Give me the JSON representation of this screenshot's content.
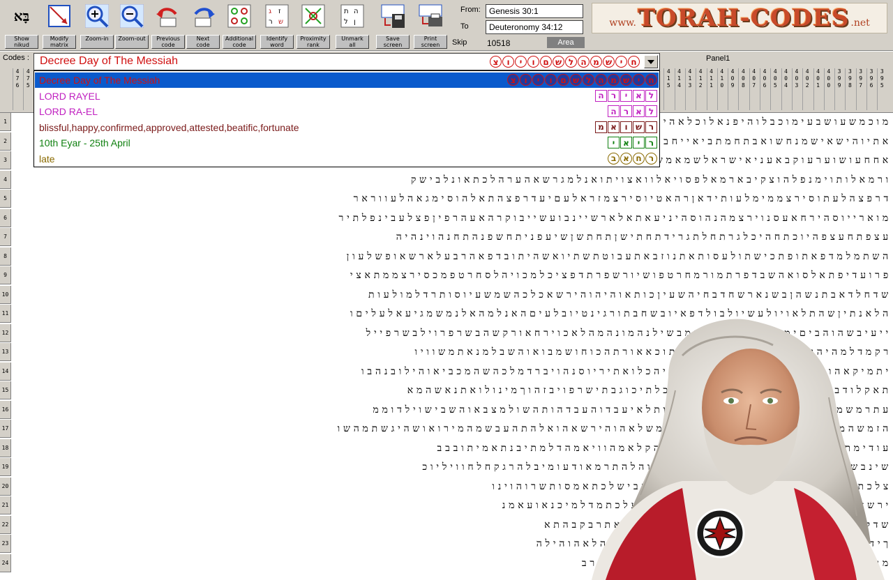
{
  "toolbar": {
    "buttons": [
      {
        "id": "show-nikud",
        "label": "Show\nnikud",
        "icon": "hebrew-nikud-icon"
      },
      {
        "id": "modify-matrix",
        "label": "Modify\nmatrix",
        "icon": "matrix-arrow-icon"
      },
      {
        "id": "zoom-in",
        "label": "Zoom-in",
        "icon": "zoom-in-icon"
      },
      {
        "id": "zoom-out",
        "label": "Zoom-out",
        "icon": "zoom-out-icon"
      },
      {
        "id": "previous-code",
        "label": "Previous\ncode",
        "icon": "previous-arrow-icon"
      },
      {
        "id": "next-code",
        "label": "Next\ncode",
        "icon": "next-arrow-icon"
      },
      {
        "id": "additional-code",
        "label": "Additional\ncode",
        "icon": "additional-grid-icon"
      },
      {
        "id": "identify-word",
        "label": "Identify\nword",
        "icon": "identify-grid-icon"
      },
      {
        "id": "proximity-rank",
        "label": "Proximity\nrank",
        "icon": "proximity-grid-icon"
      },
      {
        "id": "unmark-all",
        "label": "Unmark\nall",
        "icon": "unmark-grid-icon"
      },
      {
        "id": "save-screen",
        "label": "Save\nscreen",
        "icon": "floppy-disk-icon"
      },
      {
        "id": "print-screen",
        "label": "Print\nscreen",
        "icon": "printer-icon"
      }
    ],
    "nikud_glyph": "בָּא",
    "from_label": "From:",
    "from_value": "Genesis 30:1",
    "to_label": "To",
    "to_value": "Deuteronomy 34:12",
    "skip_label": "Skip",
    "skip_value": "10518",
    "area_label": "Area",
    "logo": {
      "prefix": "www.",
      "main": "TORAH-CODES",
      "suffix": ".net"
    }
  },
  "codes": {
    "label": "Codes :",
    "panel_label": "Panel1",
    "selected_text": "Decree Day of The Messiah",
    "selected_hebrew": [
      "צ",
      "ו",
      "י",
      "ו",
      "ם",
      "ש",
      "ל",
      "ה",
      "מ",
      "ש",
      "י",
      "ח"
    ],
    "items": [
      {
        "text": "Decree Day of The Messiah",
        "color": "#d01010",
        "hebrew": [
          "צ",
          "ו",
          "י",
          "ו",
          "ם",
          "ש",
          "ל",
          "ה",
          "מ",
          "ש",
          "י",
          "ח"
        ],
        "marker": "oval",
        "selected": true
      },
      {
        "text": "LORD RAYEL",
        "color": "#c020c0",
        "hebrew": [
          "ה",
          "ר",
          "י",
          "א",
          "ל"
        ],
        "marker": "square",
        "selected": false
      },
      {
        "text": "LORD RA-EL",
        "color": "#c020c0",
        "hebrew": [
          "ה",
          "ר",
          "א",
          "ל"
        ],
        "marker": "square",
        "selected": false
      },
      {
        "text": "blissful,happy,confirmed,approved,attested,beatific,fortunate",
        "color": "#7a1a1a",
        "hebrew": [
          "מ",
          "א",
          "ו",
          "ש",
          "ר"
        ],
        "marker": "square",
        "selected": false
      },
      {
        "text": "10th Eyar - 25th April",
        "color": "#108010",
        "hebrew": [
          "י",
          "א",
          "י",
          "ר"
        ],
        "marker": "square",
        "selected": false
      },
      {
        "text": "late",
        "color": "#8a6a00",
        "hebrew": [
          "ב",
          "א",
          "ח",
          "ר"
        ],
        "marker": "oval",
        "selected": false
      }
    ]
  },
  "columns": [
    "476",
    "475",
    "474",
    "473",
    "472",
    "471",
    "470",
    "469",
    "468",
    "467",
    "466",
    "465",
    "464",
    "463",
    "462",
    "461",
    "460",
    "459",
    "458",
    "457",
    "456",
    "455",
    "454",
    "453",
    "452",
    "451",
    "450",
    "449",
    "448",
    "447",
    "446",
    "445",
    "444",
    "443",
    "442",
    "441",
    "440",
    "439",
    "438",
    "437",
    "436",
    "435",
    "434",
    "433",
    "432",
    "431",
    "430",
    "429",
    "428",
    "427",
    "426",
    "425",
    "424",
    "423",
    "422",
    "421",
    "420",
    "419",
    "418",
    "417",
    "416",
    "415",
    "414",
    "413",
    "412",
    "411",
    "410",
    "409",
    "408",
    "407",
    "406",
    "405",
    "404",
    "403",
    "402",
    "401",
    "400",
    "399",
    "398",
    "397",
    "396",
    "395"
  ],
  "rows": [
    {
      "num": "1",
      "text": "מוכמשעושבעימוכבלוהיפנאלוכלאהישוהחדלישראליכמןמהןבניכלואיםויהילאלהש"
    },
    {
      "num": "2",
      "text": "אתיוהישאישמנחשואבתחמתביאייחברהפמאיכנבהלשלדגיעד"
    },
    {
      "num": "3",
      "text": "אחחעושוערעוקבאעניאישראלשמאמשאישואיוהערלאשיאמ"
    },
    {
      "num": "4",
      "text": "ורמאלותוימנפלהוצקיבארמאלפסויאלוואצויתואנלמגרשאהערהלכתאונלבישק"
    },
    {
      "num": "5",
      "text": "דרפצהלעתוסירצממימלעותידאןרהאטיוסירצמזראלעםיעדרפצהתאלהוסימגאהלעווראר"
    },
    {
      "num": "6",
      "text": "מוארייוסהירחאעסנוירצמהנהוסהיניעאתאלארשיינבועשייבוקרהאעהרפיןפצלעבינפלתיר"
    },
    {
      "num": "7",
      "text": "עצפתחעצפהיוכתחהיכלגרתחלתגרידתחתישןתחתשןשיעפניתחשפנהתחנהוינהיה"
    },
    {
      "num": "8",
      "text": "השתמלמדפאתופתכישתולעסותאתנוזבאתעבוטתשתיואשהיתובדפאהרבעלארשאופשלעון"
    },
    {
      "num": "9",
      "text": "פרועדיפתאלסואהשבדפרתמורמחרטפושיורשפרתדפציכלמכויהלסחרטפמכסירצממתאצי"
    },
    {
      "num": "10",
      "text": "שדחלדאבתנשהןבשנארשחדבחיהשעיןכותאוהיהוהירשאכלכהשמשעיוסותרדלמולעות"
    },
    {
      "num": "11",
      "text": "הלאנתיןשהתלאויולעשיולבולדפאיובשחבתורגינטיובלעיםהאנלמהאלנמשמגיעאלעליםו"
    },
    {
      "num": "12",
      "text": "ייעיבשהוהביםימתעבשולהאלוךמבשילנהמונהמהלאכוירחאורקשהבשרפרוילבשרפייל"
    },
    {
      "num": "13",
      "text": "רקמדלמהיהרחאנוזלוירחאסניהלאתוכאאורתהכוחושמבואוהשבלמנאתמשוויו"
    },
    {
      "num": "14",
      "text": "יתמיקאהומכאיתיבהרבאוהכתאליוסיהכלואתיריוסנהויברדמלכהשהמכביאוהילובנהבו"
    },
    {
      "num": "15",
      "text": "תאקלודבתאויומשחתרעסכמובתארוכלתיכוגבתישרפויבזהוךמינולואתנאשהמא"
    },
    {
      "num": "16",
      "text": "עתרמשמרמולדעובלואבתשואתעוישותלאיעבדוהעבדהותהשולמצבאוהשבישוילדוממ"
    },
    {
      "num": "17",
      "text": "הזמשהמדיבכסכילאהוהיוצוכלאשאהמשלאהוהירשאהואלהתהעבשמהמירואושהיגשתמהשו"
    },
    {
      "num": "18",
      "text": "עודימתורוחנעשאזקיוןשראוהמלחמדהקלאמהוויאמהדלמתיבנתאמיתובבב"
    },
    {
      "num": "19",
      "text": "שינבשחוהיכלהבוריקתכרשאשאהחבזמוהלהתרמאודעומיבלהרגקחלחוויליוכ"
    },
    {
      "num": "20",
      "text": "צלכתאהנשכמלתאסבדבואשכםויפמזראהבישלכתאמסותשרוהוינו"
    },
    {
      "num": "21",
      "text": "ירשאהתסתדשרויסוטאבוניחתעמלשתוריעלכתמדלמיכנאועאמנ"
    },
    {
      "num": "22",
      "text": "שדקמכתאוהאיחלשוביותאויסתאנצפקמהותאתרבקבהתא"
    },
    {
      "num": "23",
      "text": "ךידיהלאהוהיוכרביכוהנכהירחביבשאוקומבךיהלאהוהילה"
    },
    {
      "num": "24",
      "text": "מוטילךגלרדיאראפתאלדתיזטבחתכיןידימשלמכרב"
    }
  ]
}
